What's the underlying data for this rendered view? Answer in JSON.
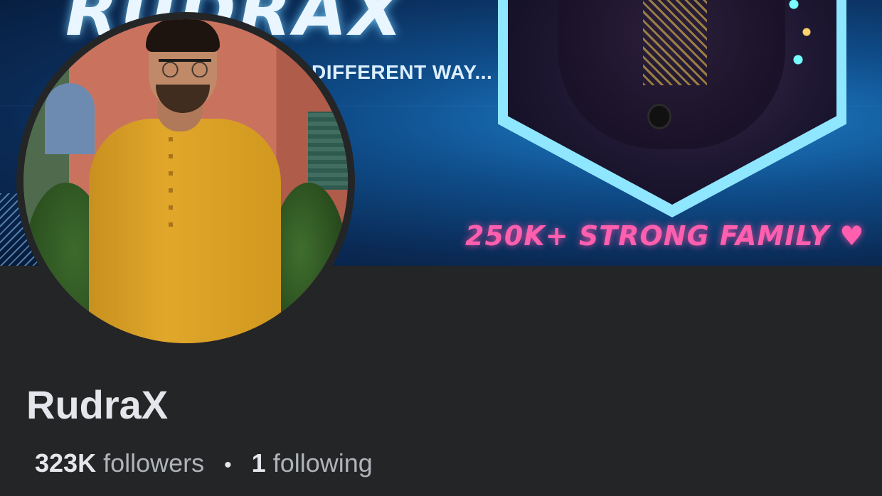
{
  "cover": {
    "title": "RUDRAX",
    "tagline": "DIFFERENT WAY...",
    "banner_text": "250K+ STRONG FAMILY ♥",
    "colors": {
      "glow": "#4fd3ff",
      "banner": "#ff5fae"
    }
  },
  "profile": {
    "name": "RudraX",
    "followers_count": "323K",
    "followers_label": "followers",
    "separator": "•",
    "following_count": "1",
    "following_label": "following"
  },
  "theme": {
    "background": "#242526",
    "text_primary": "#e4e6eb",
    "text_secondary": "#b0b3b8"
  }
}
